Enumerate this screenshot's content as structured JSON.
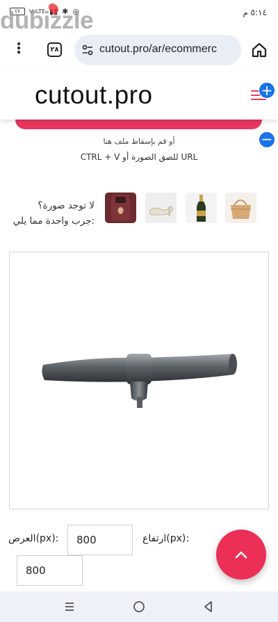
{
  "status_bar": {
    "time": "٥:١٤ م",
    "battery": "٤٧",
    "network": "VoLTE"
  },
  "watermark": {
    "text": "dubizzle"
  },
  "browser": {
    "tab_count": "٢٨",
    "url": "cutout.pro/ar/ecommerc"
  },
  "header": {
    "logo": "cutout.pro",
    "menu_icon": "hamburger-menu-icon"
  },
  "upload": {
    "drop_text": "أو قم بإسقاط ملف هنا",
    "paste_text": "URL للصق الصورة أو CTRL + V"
  },
  "samples": {
    "label_line1": "لا توجد صورة؟",
    "label_line2": ":جرب واحدة مما يلي",
    "thumbnails": [
      "handbag",
      "champagne-bottle",
      "shoe",
      "phone-case"
    ]
  },
  "size": {
    "width_label": "العرض(px):",
    "width_value": "800",
    "height_label": "ارتفاع(px):",
    "height_value": "800"
  },
  "colors": {
    "accent": "#ec2f57",
    "blue_fab": "#1a73e8"
  }
}
